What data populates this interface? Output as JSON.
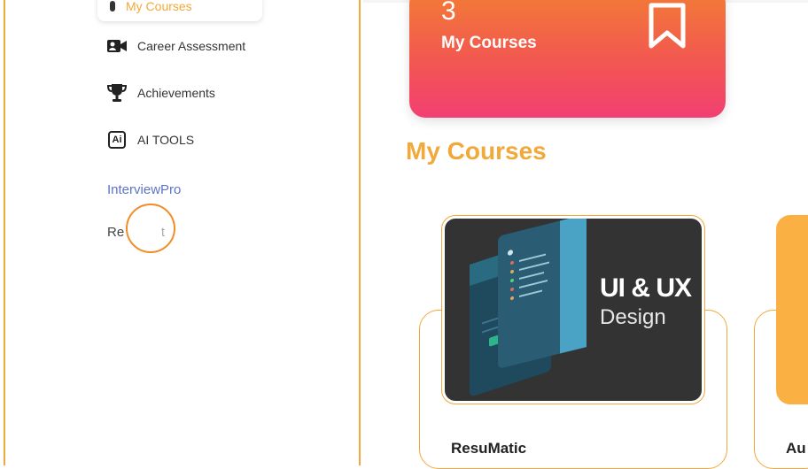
{
  "sidebar": {
    "active_item": {
      "label": "My Courses",
      "icon": "phone-icon"
    },
    "items": [
      {
        "label": "Career Assessment",
        "icon": "video-camera-icon"
      },
      {
        "label": "Achievements",
        "icon": "trophy-icon"
      },
      {
        "label": "AI TOOLS",
        "icon": "ai-icon",
        "icon_text": "Ai"
      }
    ],
    "links": [
      {
        "label": "InterviewPro",
        "color": "#5b74c8"
      },
      {
        "label": "Re          t"
      }
    ]
  },
  "stat_card": {
    "count": "3",
    "label": "My Courses",
    "icon": "bookmark-icon"
  },
  "section": {
    "title": "My Courses"
  },
  "courses": [
    {
      "name": "ResuMatic",
      "thumbnail": {
        "title_line1": "UI & UX",
        "title_line2": "Design"
      }
    },
    {
      "name": "Au"
    }
  ],
  "colors": {
    "accent": "#f0a93a",
    "card_gradient_top": "#f27d35",
    "card_gradient_bottom": "#f23f72",
    "link_blue": "#5b74c8"
  }
}
